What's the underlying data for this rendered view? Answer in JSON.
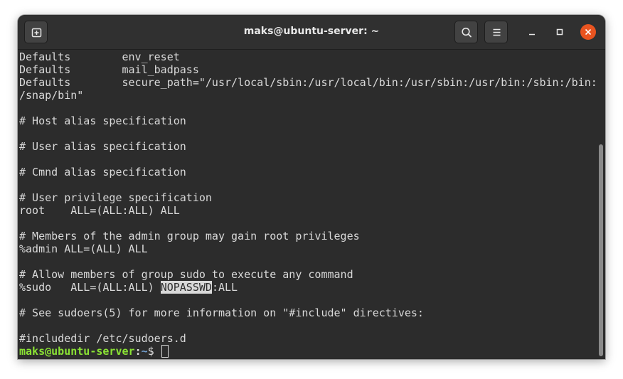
{
  "window": {
    "title": "maks@ubuntu-server: ~"
  },
  "titlebar_icons": {
    "new_tab": "new-tab-icon",
    "search": "search-icon",
    "menu": "hamburger-menu-icon",
    "minimize": "minimize-icon",
    "maximize": "maximize-icon",
    "close": "close-icon"
  },
  "colors": {
    "terminal_bg": "#2c2c2c",
    "terminal_fg": "#d9d9d9",
    "prompt_user": "#8ae234",
    "prompt_path": "#729fcf",
    "close_button": "#e95420"
  },
  "terminal": {
    "lines": [
      "Defaults        env_reset",
      "Defaults        mail_badpass",
      "Defaults        secure_path=\"/usr/local/sbin:/usr/local/bin:/usr/sbin:/usr/bin:/sbin:/bin:",
      "/snap/bin\"",
      "",
      "# Host alias specification",
      "",
      "# User alias specification",
      "",
      "# Cmnd alias specification",
      "",
      "# User privilege specification",
      "root    ALL=(ALL:ALL) ALL",
      "",
      "# Members of the admin group may gain root privileges",
      "%admin ALL=(ALL) ALL",
      "",
      "# Allow members of group sudo to execute any command"
    ],
    "sudo_line": {
      "before": "%sudo   ALL=(ALL:ALL) ",
      "highlight": "NOPASSWD",
      "after": ":ALL"
    },
    "lines_after": [
      "",
      "# See sudoers(5) for more information on \"#include\" directives:",
      "",
      "#includedir /etc/sudoers.d"
    ],
    "prompt": {
      "user_host": "maks@ubuntu-server",
      "separator": ":",
      "path": "~",
      "symbol": "$ "
    }
  },
  "scrollbar": {
    "position_fraction": 1.0,
    "visible_fraction": 0.7
  }
}
